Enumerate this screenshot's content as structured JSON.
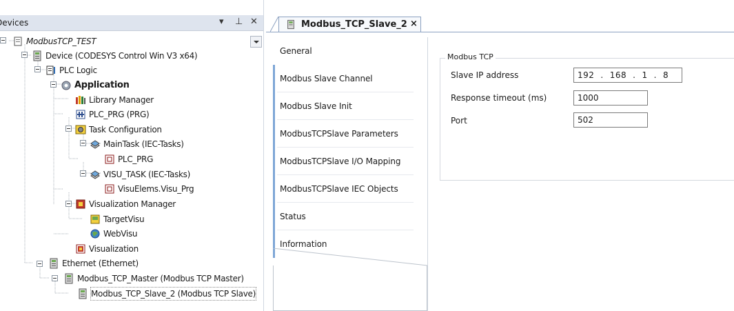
{
  "devices": {
    "title": "Devices",
    "tree": [
      {
        "label": "ModbusTCP_TEST",
        "icon": "project-icon"
      },
      {
        "label": "Device (CODESYS Control Win V3 x64)",
        "icon": "device-icon"
      },
      {
        "label": "PLC Logic",
        "icon": "plc-logic-icon"
      },
      {
        "label": "Application",
        "icon": "application-gear-icon"
      },
      {
        "label": "Library Manager",
        "icon": "library-manager-icon"
      },
      {
        "label": "PLC_PRG (PRG)",
        "icon": "program-icon"
      },
      {
        "label": "Task Configuration",
        "icon": "task-configuration-icon"
      },
      {
        "label": "MainTask (IEC-Tasks)",
        "icon": "task-icon"
      },
      {
        "label": "PLC_PRG",
        "icon": "program-call-icon"
      },
      {
        "label": "VISU_TASK (IEC-Tasks)",
        "icon": "task-icon"
      },
      {
        "label": "VisuElems.Visu_Prg",
        "icon": "program-call-icon"
      },
      {
        "label": "Visualization Manager",
        "icon": "visualization-manager-icon"
      },
      {
        "label": "TargetVisu",
        "icon": "target-visu-icon"
      },
      {
        "label": "WebVisu",
        "icon": "web-visu-icon"
      },
      {
        "label": "Visualization",
        "icon": "visualization-icon"
      },
      {
        "label": "Ethernet (Ethernet)",
        "icon": "device-icon"
      },
      {
        "label": "Modbus_TCP_Master (Modbus TCP Master)",
        "icon": "device-icon"
      },
      {
        "label": "Modbus_TCP_Slave_2 (Modbus TCP Slave)",
        "icon": "device-icon"
      }
    ]
  },
  "editor": {
    "tab_title": "Modbus_TCP_Slave_2",
    "tab_close": "×",
    "side_tabs": [
      "General",
      "Modbus Slave Channel",
      "Modbus Slave Init",
      "ModbusTCPSlave Parameters",
      "ModbusTCPSlave I/O Mapping",
      "ModbusTCPSlave IEC Objects",
      "Status",
      "Information"
    ],
    "group_title": "Modbus TCP",
    "slave_ip_label": "Slave IP address",
    "ip_octets": [
      "192",
      "168",
      "1",
      "8"
    ],
    "timeout_label": "Response timeout (ms)",
    "timeout_value": "1000",
    "port_label": "Port",
    "port_value": "502"
  },
  "colors": {
    "header_bg": "#dee4ee",
    "accent_bar": "#7ea6d6"
  }
}
